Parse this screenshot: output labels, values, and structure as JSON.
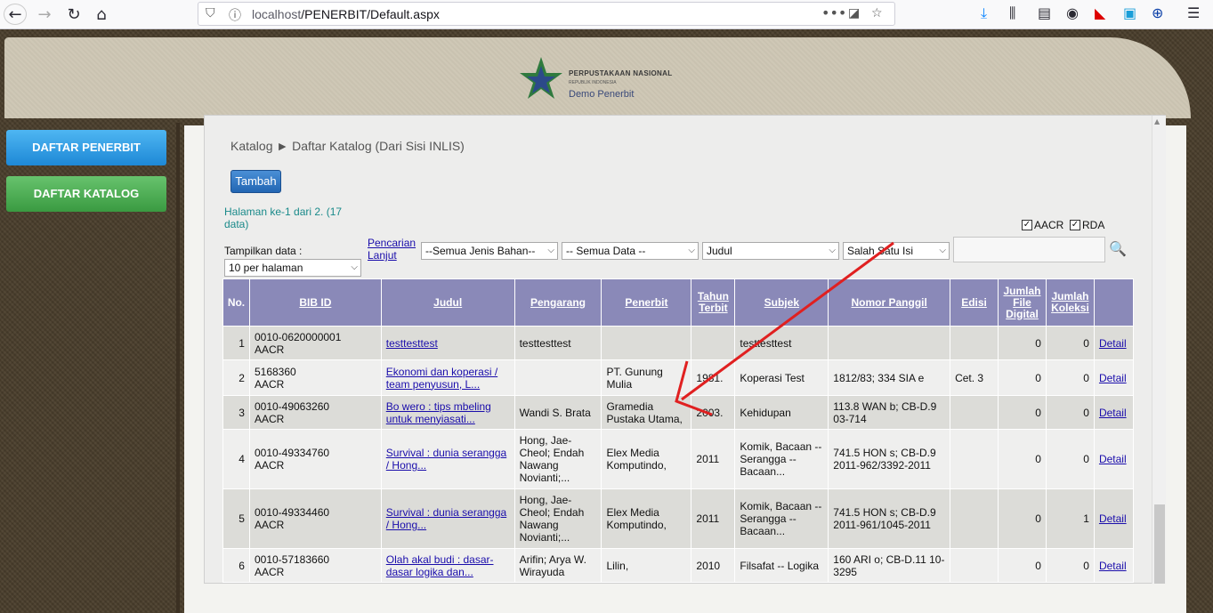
{
  "browser": {
    "url_host": "localhost",
    "url_path": "/PENERBIT/Default.aspx"
  },
  "header": {
    "logo_line1": "PERPUSTAKAAN NASIONAL",
    "logo_line2": "REPUBLIK INDONESIA",
    "logo_line3": "Demo Penerbit"
  },
  "sidebar": {
    "items": [
      {
        "label": "DAFTAR PENERBIT"
      },
      {
        "label": "DAFTAR KATALOG"
      }
    ]
  },
  "main": {
    "breadcrumb": "Katalog ► Daftar Katalog (Dari Sisi INLIS)",
    "add_button": "Tambah",
    "page_info": "Halaman ke-1 dari 2. (17 data)",
    "checkbox_aacr": "AACR",
    "checkbox_rda": "RDA",
    "show_label": "Tampilkan data :",
    "per_page": "10 per halaman",
    "advanced_search": "Pencarian Lanjut",
    "filter_material": "--Semua Jenis Bahan--",
    "filter_data": "-- Semua Data --",
    "filter_field": "Judul",
    "filter_match": "Salah Satu Isi",
    "search_value": ""
  },
  "table": {
    "headers": [
      "No.",
      "BIB ID",
      "Judul",
      "Pengarang",
      "Penerbit",
      "Tahun Terbit",
      "Subjek",
      "Nomor Panggil",
      "Edisi",
      "Jumlah File Digital",
      "Jumlah Koleksi",
      ""
    ],
    "rows": [
      {
        "no": "1",
        "bib1": "0010-0620000001",
        "bib2": "AACR",
        "judul": "testtesttest",
        "pengarang": "testtesttest",
        "penerbit": "",
        "tahun": "",
        "subjek": "testtesttest",
        "nomor": "",
        "edisi": "",
        "file": "0",
        "koleksi": "0",
        "detail": "Detail"
      },
      {
        "no": "2",
        "bib1": "5168360",
        "bib2": "AACR",
        "judul": "Ekonomi dan koperasi / team penyusun, L...",
        "pengarang": "",
        "penerbit": "PT. Gunung Mulia",
        "tahun": "1981.",
        "subjek": "Koperasi Test",
        "nomor": "1812/83; 334 SIA e",
        "edisi": "Cet. 3",
        "file": "0",
        "koleksi": "0",
        "detail": "Detail"
      },
      {
        "no": "3",
        "bib1": "0010-49063260",
        "bib2": "AACR",
        "judul": "Bo wero : tips mbeling untuk menyiasati...",
        "pengarang": "Wandi S. Brata",
        "penerbit": "Gramedia Pustaka Utama,",
        "tahun": "2003.",
        "subjek": "Kehidupan",
        "nomor": "113.8 WAN b; CB-D.9 03-714",
        "edisi": "",
        "file": "0",
        "koleksi": "0",
        "detail": "Detail"
      },
      {
        "no": "4",
        "bib1": "0010-49334760",
        "bib2": "AACR",
        "judul": "Survival : dunia serangga / Hong...",
        "pengarang": "Hong, Jae-Cheol; Endah Nawang Novianti;...",
        "penerbit": "Elex Media Komputindo,",
        "tahun": "2011",
        "subjek": "Komik, Bacaan -- Serangga -- Bacaan...",
        "nomor": "741.5 HON s; CB-D.9 2011-962/3392-2011",
        "edisi": "",
        "file": "0",
        "koleksi": "0",
        "detail": "Detail"
      },
      {
        "no": "5",
        "bib1": "0010-49334460",
        "bib2": "AACR",
        "judul": "Survival : dunia serangga / Hong...",
        "pengarang": "Hong, Jae-Cheol; Endah Nawang Novianti;...",
        "penerbit": "Elex Media Komputindo,",
        "tahun": "2011",
        "subjek": "Komik, Bacaan -- Serangga -- Bacaan...",
        "nomor": "741.5 HON s; CB-D.9 2011-961/1045-2011",
        "edisi": "",
        "file": "0",
        "koleksi": "1",
        "detail": "Detail"
      },
      {
        "no": "6",
        "bib1": "0010-57183660",
        "bib2": "AACR",
        "judul": "Olah akal budi : dasar-dasar logika dan...",
        "pengarang": "Arifin; Arya W. Wirayuda",
        "penerbit": "Lilin,",
        "tahun": "2010",
        "subjek": "Filsafat -- Logika",
        "nomor": "160 ARI o; CB-D.11 10-3295",
        "edisi": "",
        "file": "0",
        "koleksi": "0",
        "detail": "Detail"
      }
    ]
  },
  "colors": {
    "table_header": "#8a89b8",
    "annotation_arrow": "#e02020",
    "link": "#1a0dab"
  }
}
